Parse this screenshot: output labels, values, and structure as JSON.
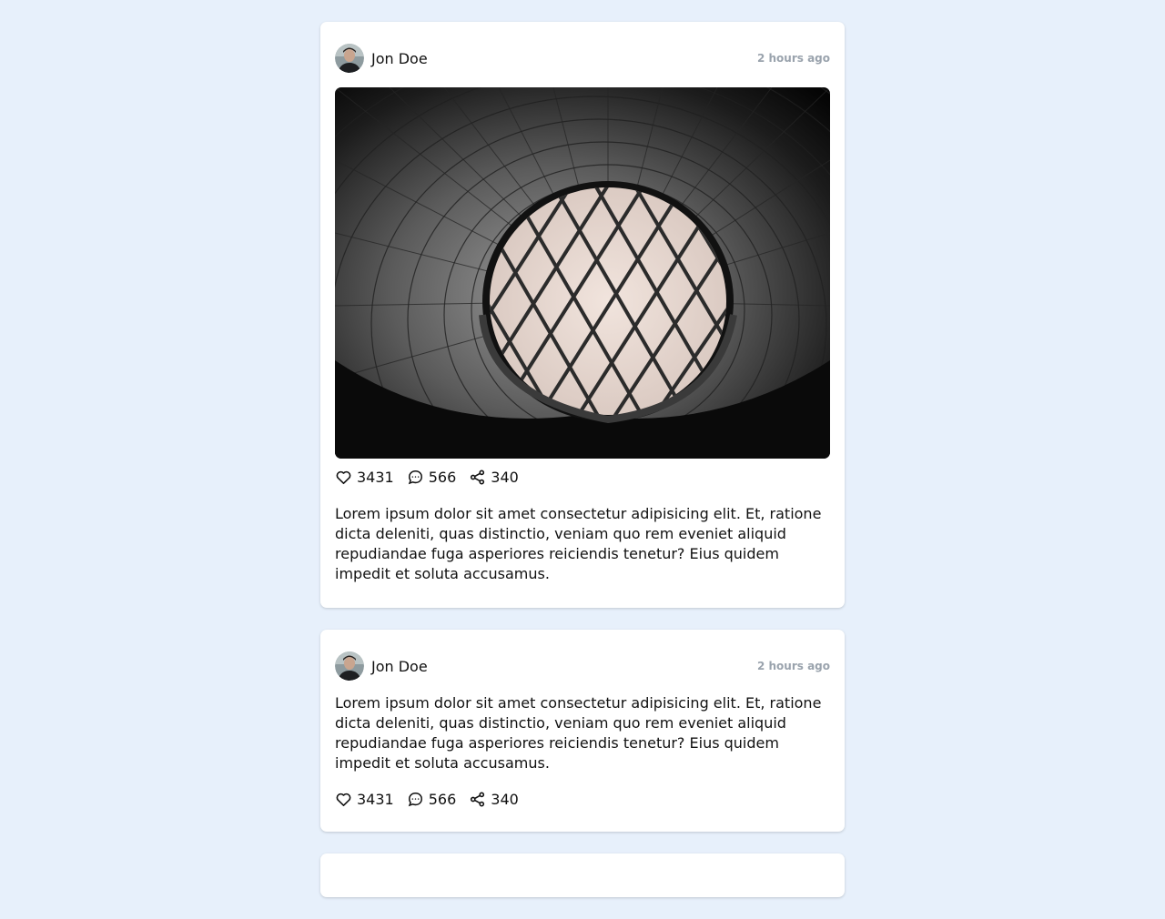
{
  "posts": [
    {
      "author": "Jon Doe",
      "time": "2 hours ago",
      "likes": "3431",
      "comments": "566",
      "shares": "340",
      "text": "Lorem ipsum dolor sit amet consectetur adipisicing elit. Et, ratione dicta deleniti, quas distinctio, veniam quo rem eveniet aliquid repudiandae fuga asperiores reiciendis tenetur? Eius quidem impedit et soluta accusamus.",
      "has_image": true
    },
    {
      "author": "Jon Doe",
      "time": "2 hours ago",
      "likes": "3431",
      "comments": "566",
      "shares": "340",
      "text": "Lorem ipsum dolor sit amet consectetur adipisicing elit. Et, ratione dicta deleniti, quas distinctio, veniam quo rem eveniet aliquid repudiandae fuga asperiores reiciendis tenetur? Eius quidem impedit et soluta accusamus.",
      "has_image": false
    }
  ],
  "icons": {
    "like": "heart-icon",
    "comment": "comment-icon",
    "share": "share-icon"
  },
  "colors": {
    "page_background": "#e7f0fb",
    "card_background": "#ffffff",
    "timestamp": "#9aa3ad"
  }
}
